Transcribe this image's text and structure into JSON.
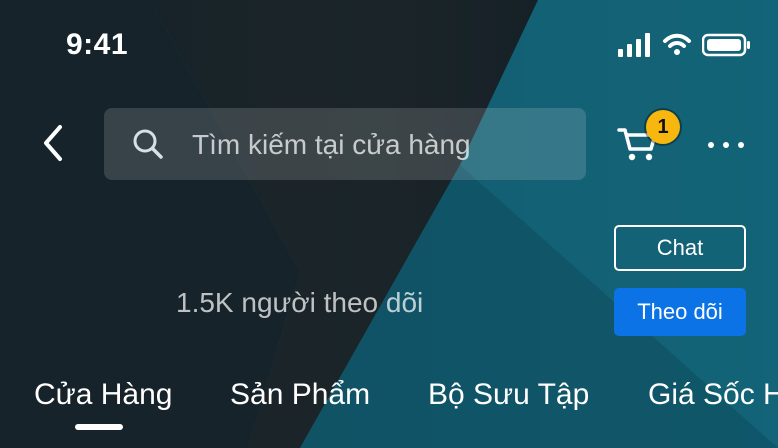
{
  "status_bar": {
    "time": "9:41",
    "icons": [
      "signal-icon",
      "wifi-icon",
      "battery-icon"
    ]
  },
  "header": {
    "search": {
      "placeholder": "Tìm kiếm tại cửa hàng"
    },
    "cart": {
      "badge_count": "1"
    },
    "icons": {
      "back": "chevron-left-icon",
      "search": "search-icon",
      "cart": "cart-icon",
      "more": "more-horizontal-icon"
    }
  },
  "shop": {
    "follower_count": "1.5K người theo dõi",
    "chat_label": "Chat",
    "follow_label": "Theo dõi"
  },
  "tabs": [
    {
      "label": "Cửa Hàng"
    },
    {
      "label": "Sản Phẩm"
    },
    {
      "label": "Bộ Sưu Tập"
    },
    {
      "label": "Giá Sốc H"
    }
  ],
  "colors": {
    "accent": "#0b73e6",
    "badge": "#f7b70f"
  }
}
